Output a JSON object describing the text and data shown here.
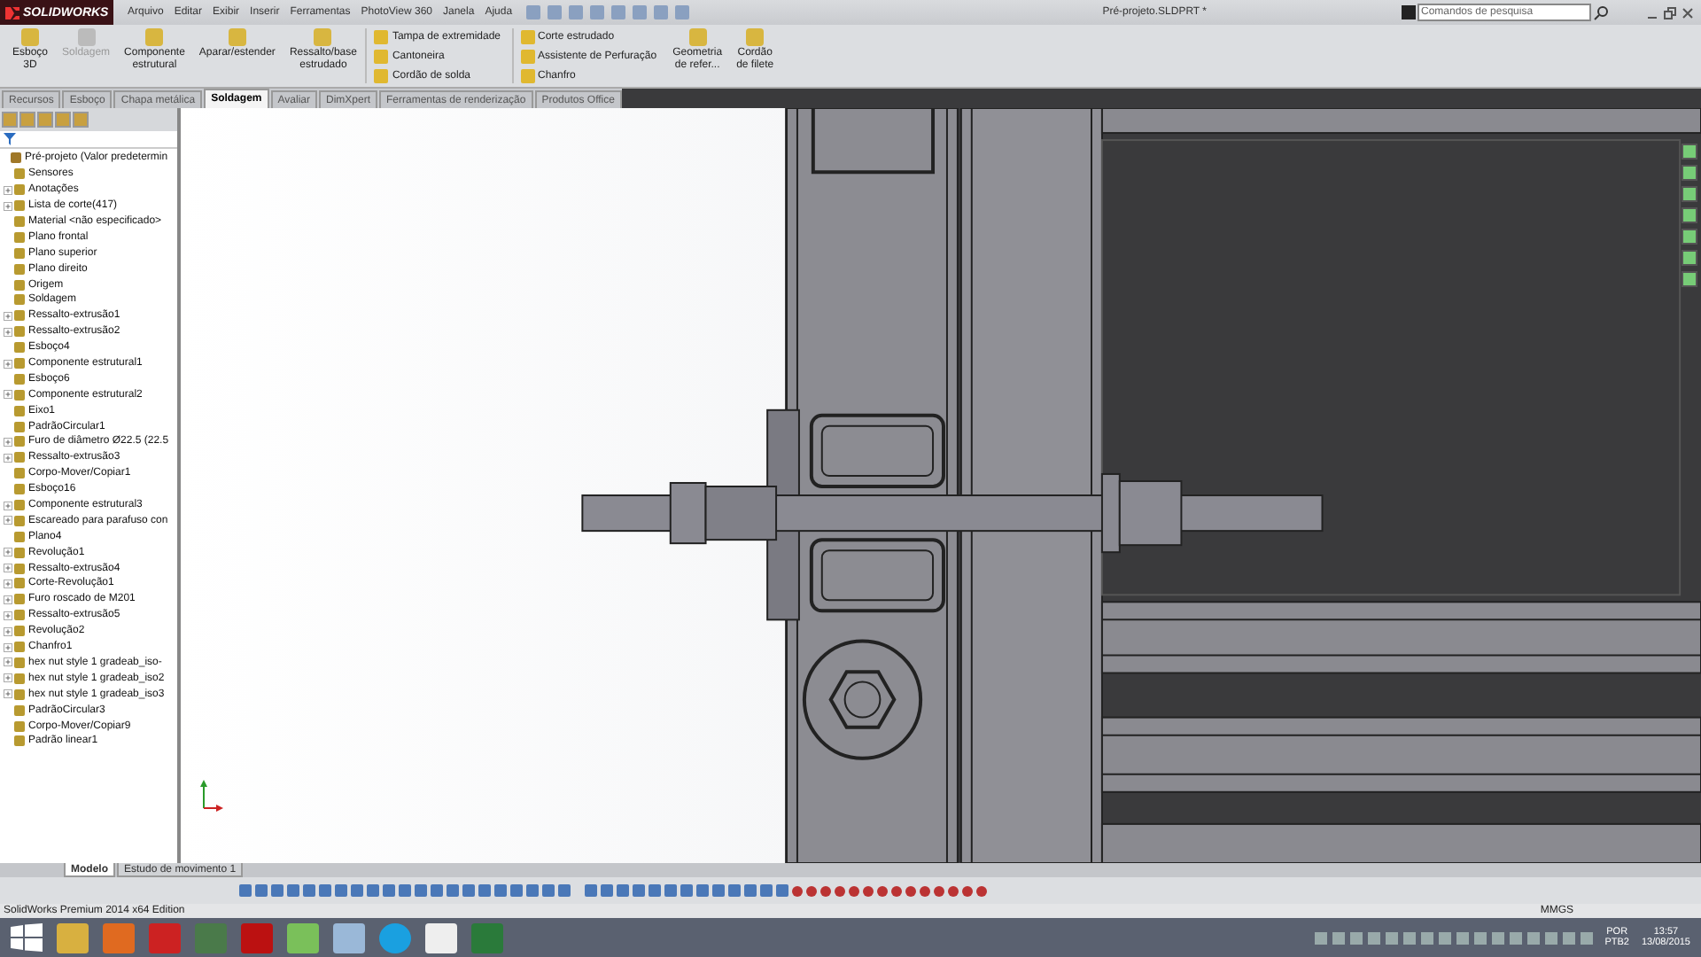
{
  "app": {
    "logo": "SOLIDWORKS",
    "menu": [
      "Arquivo",
      "Editar",
      "Exibir",
      "Inserir",
      "Ferramentas",
      "PhotoView 360",
      "Janela",
      "Ajuda"
    ],
    "title": "Pré-projeto.SLDPRT *",
    "search": {
      "placeholder": "Comandos de pesquisa"
    }
  },
  "ribbon": [
    {
      "kind": "large",
      "label": "Esboço\n3D",
      "disabled": false
    },
    {
      "kind": "large",
      "label": "Soldagem",
      "disabled": true
    },
    {
      "kind": "large",
      "label": "Componente\nestrutural",
      "disabled": false
    },
    {
      "kind": "large",
      "label": "Aparar/estender",
      "disabled": false
    },
    {
      "kind": "large",
      "label": "Ressalto/base\nestrudado",
      "disabled": false
    },
    {
      "kind": "column",
      "items": [
        "Tampa de extremidade",
        "Cantoneira",
        "Cordão de solda"
      ]
    },
    {
      "kind": "column",
      "items": [
        "Corte estrudado",
        "Assistente de Perfuração",
        "Chanfro"
      ]
    },
    {
      "kind": "large",
      "label": "Geometria\nde refer...",
      "disabled": false
    },
    {
      "kind": "large",
      "label": "Cordão\nde filete",
      "disabled": false
    }
  ],
  "tabs": [
    {
      "label": "Recursos",
      "selected": false
    },
    {
      "label": "Esboço",
      "selected": false
    },
    {
      "label": "Chapa metálica",
      "selected": false
    },
    {
      "label": "Soldagem",
      "selected": true
    },
    {
      "label": "Avaliar",
      "selected": false
    },
    {
      "label": "DimXpert",
      "selected": false
    },
    {
      "label": "Ferramentas de renderização",
      "selected": false
    },
    {
      "label": "Produtos Office",
      "selected": false
    }
  ],
  "tree": [
    {
      "label": "Pré-projeto  (Valor predetermin",
      "children": [
        {
          "label": "Sensores",
          "collapsed": false
        },
        {
          "label": "Anotações",
          "collapsed": true
        },
        {
          "label": "Lista de corte(417)",
          "collapsed": true
        },
        {
          "label": "Material <não especificado>",
          "collapsed": false
        },
        {
          "label": "Plano frontal",
          "collapsed": false
        },
        {
          "label": "Plano superior",
          "collapsed": false
        },
        {
          "label": "Plano direito",
          "collapsed": false
        },
        {
          "label": "Origem",
          "collapsed": false
        },
        {
          "label": "Soldagem",
          "collapsed": false
        },
        {
          "label": "Ressalto-extrusão1",
          "collapsed": true
        },
        {
          "label": "Ressalto-extrusão2",
          "collapsed": true
        },
        {
          "label": "Esboço4",
          "collapsed": false
        },
        {
          "label": "Componente estrutural1",
          "collapsed": true
        },
        {
          "label": "Esboço6",
          "collapsed": false
        },
        {
          "label": "Componente estrutural2",
          "collapsed": true
        },
        {
          "label": "Eixo1",
          "collapsed": false
        },
        {
          "label": "PadrãoCircular1",
          "collapsed": false
        },
        {
          "label": "Furo de diâmetro Ø22.5 (22.5",
          "collapsed": true
        },
        {
          "label": "Ressalto-extrusão3",
          "collapsed": true
        },
        {
          "label": "Corpo-Mover/Copiar1",
          "collapsed": false
        },
        {
          "label": "Esboço16",
          "collapsed": false
        },
        {
          "label": "Componente estrutural3",
          "collapsed": true
        },
        {
          "label": "Escareado para parafuso con",
          "collapsed": true
        },
        {
          "label": "Plano4",
          "collapsed": false
        },
        {
          "label": "Revolução1",
          "collapsed": true
        },
        {
          "label": "Ressalto-extrusão4",
          "collapsed": true
        },
        {
          "label": "Corte-Revolução1",
          "collapsed": true
        },
        {
          "label": "Furo roscado de M201",
          "collapsed": true
        },
        {
          "label": "Ressalto-extrusão5",
          "collapsed": true
        },
        {
          "label": "Revolução2",
          "collapsed": true
        },
        {
          "label": "Chanfro1",
          "collapsed": true
        },
        {
          "label": "hex nut style 1 gradeab_iso-",
          "collapsed": true
        },
        {
          "label": "hex nut style 1 gradeab_iso2",
          "collapsed": true
        },
        {
          "label": "hex nut style 1 gradeab_iso3",
          "collapsed": true
        },
        {
          "label": "PadrãoCircular3",
          "collapsed": false
        },
        {
          "label": "Corpo-Mover/Copiar9",
          "collapsed": false
        },
        {
          "label": "Padrão linear1",
          "collapsed": false
        }
      ]
    }
  ],
  "bottom_tabs": [
    {
      "label": "Modelo",
      "selected": true
    },
    {
      "label": "Estudo de movimento 1",
      "selected": false
    }
  ],
  "status_bar": {
    "edition": "SolidWorks Premium 2014 x64 Edition",
    "units": "MMGS"
  },
  "taskbar": {
    "language": "POR",
    "layout": "PTB2",
    "time": "13:57",
    "date": "13/08/2015"
  }
}
